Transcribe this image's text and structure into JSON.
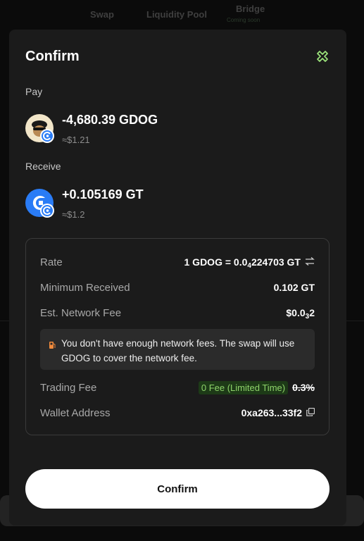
{
  "background": {
    "tabs": [
      "Swap",
      "Liquidity Pool",
      "Bridge"
    ],
    "bridge_sub": "Coming soon"
  },
  "modal": {
    "title": "Confirm",
    "pay": {
      "label": "Pay",
      "amount": "-4,680.39 GDOG",
      "usd": "≈$1.21",
      "icon": "gdog-token-icon"
    },
    "receive": {
      "label": "Receive",
      "amount": "+0.105169 GT",
      "usd": "≈$1.2",
      "icon": "gt-token-icon"
    },
    "details": {
      "rate_label": "Rate",
      "rate_prefix": "1 GDOG = 0.0",
      "rate_sub": "4",
      "rate_suffix": "224703 GT",
      "min_received_label": "Minimum Received",
      "min_received_value": "0.102 GT",
      "network_fee_label": "Est. Network Fee",
      "network_fee_prefix": "$0.0",
      "network_fee_sub": "3",
      "network_fee_suffix": "2",
      "notice": "You don't have enough network fees. The swap will use GDOG to cover the network fee.",
      "trading_fee_label": "Trading Fee",
      "trading_fee_badge": "0 Fee (Limited Time)",
      "trading_fee_original": "0.3%",
      "wallet_label": "Wallet Address",
      "wallet_value": "0xa263...33f2"
    },
    "confirm_button": "Confirm"
  },
  "colors": {
    "accent_green": "#8ed36a",
    "modal_bg": "#1b1b1b",
    "button_bg": "#ffffff"
  }
}
